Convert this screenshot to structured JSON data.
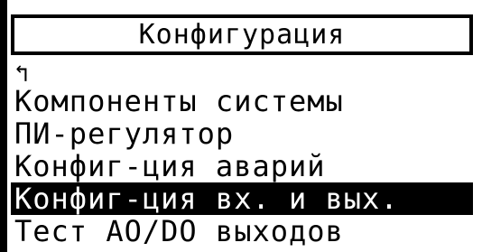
{
  "screen": {
    "title": "Конфигурация"
  },
  "menu": {
    "back_icon_glyph": "↰",
    "back_icon_name": "back-arrow-icon",
    "items": [
      {
        "label": "Компоненты системы"
      },
      {
        "label": "ПИ-регулятор"
      },
      {
        "label": "Конфиг-ция аварий"
      },
      {
        "label": "Конфиг-ция вх. и вых.",
        "selected": true
      },
      {
        "label": "Тест AO/DO выходов"
      }
    ]
  },
  "colors": {
    "background": "#ffffff",
    "foreground": "#000000",
    "selection_bg": "#000000",
    "selection_fg": "#ffffff"
  }
}
